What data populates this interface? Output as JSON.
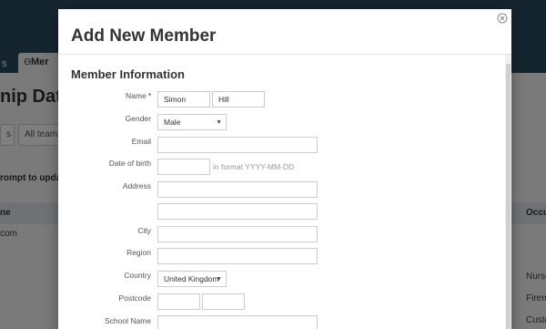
{
  "background": {
    "tab_left": "s",
    "tab_active_label": "Mer",
    "page_title": "nip Datab",
    "filter_left": "s",
    "filter_teams": "All teams",
    "prompt_text": "rompt to update",
    "table_head_left": "ne",
    "table_head_right": "Occup",
    "row1_left": "com",
    "col_right_values": [
      "Nurse",
      "Firem",
      "Custo"
    ]
  },
  "modal": {
    "title": "Add New Member",
    "close_glyph": "×",
    "section_title": "Member Information"
  },
  "form": {
    "name_label": "Name",
    "name_required": "*",
    "first_name": "Simon",
    "last_name": "Hill",
    "gender_label": "Gender",
    "gender_value": "Male",
    "email_label": "Email",
    "email_value": "",
    "dob_label": "Date of birth",
    "dob_value": "",
    "dob_hint": "in format YYYY-MM-DD",
    "address_label": "Address",
    "address_line1": "",
    "address_line2": "",
    "city_label": "City",
    "city_value": "",
    "region_label": "Region",
    "region_value": "",
    "country_label": "Country",
    "country_value": "United Kingdom",
    "postcode_label": "Postcode",
    "postcode_part1": "",
    "postcode_part2": "",
    "school_label": "School Name",
    "school_value": ""
  },
  "colors": {
    "header_bg": "#2b4a61",
    "required": "#cc0000"
  },
  "icons": {
    "close": "close-icon",
    "caret": "chevron-down-icon",
    "tab": "users-icon"
  }
}
